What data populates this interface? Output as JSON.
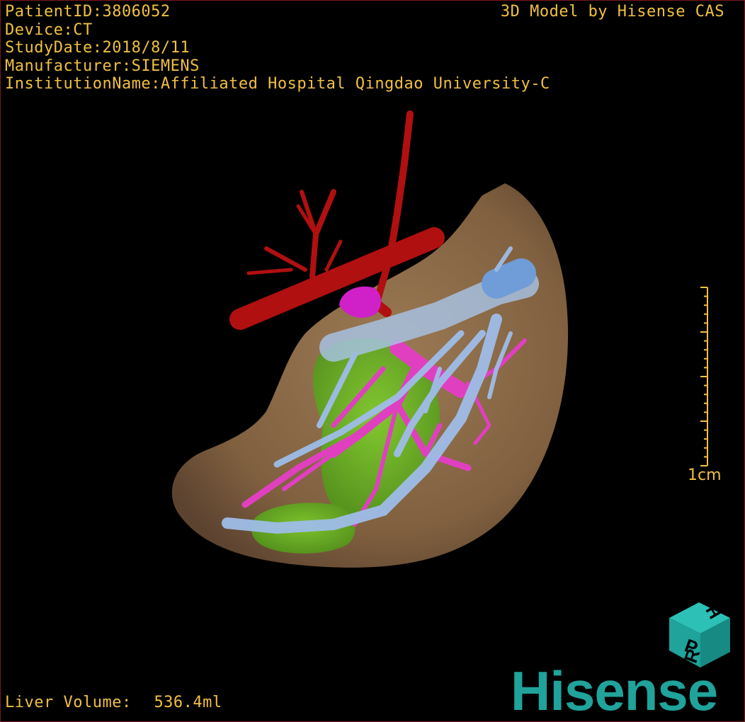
{
  "info": {
    "patient_id": "PatientID:3806052",
    "device": "Device:CT",
    "study_date": "StudyDate:2018/8/11",
    "manufacturer": "Manufacturer:SIEMENS",
    "institution": "InstitutionName:Affiliated Hospital Qingdao University-C"
  },
  "model_credit": "3D Model by Hisense CAS",
  "liver_volume": {
    "label": "Liver Volume:",
    "value": "536.4ml"
  },
  "scale_bar": {
    "label": "1cm"
  },
  "orientation_cube": {
    "faces": [
      "P",
      "R",
      "H"
    ],
    "icon": "orientation-cube-icon"
  },
  "logo": {
    "text": "Hisense"
  },
  "colors": {
    "overlay_text": "#f0c040",
    "liver": "#8a6a48",
    "artery": "#b01010",
    "portal_vein": "#e040c0",
    "hepatic_vein": "#8fb3e6",
    "tumor": "#6cc020",
    "cube": "#1fa39b"
  }
}
